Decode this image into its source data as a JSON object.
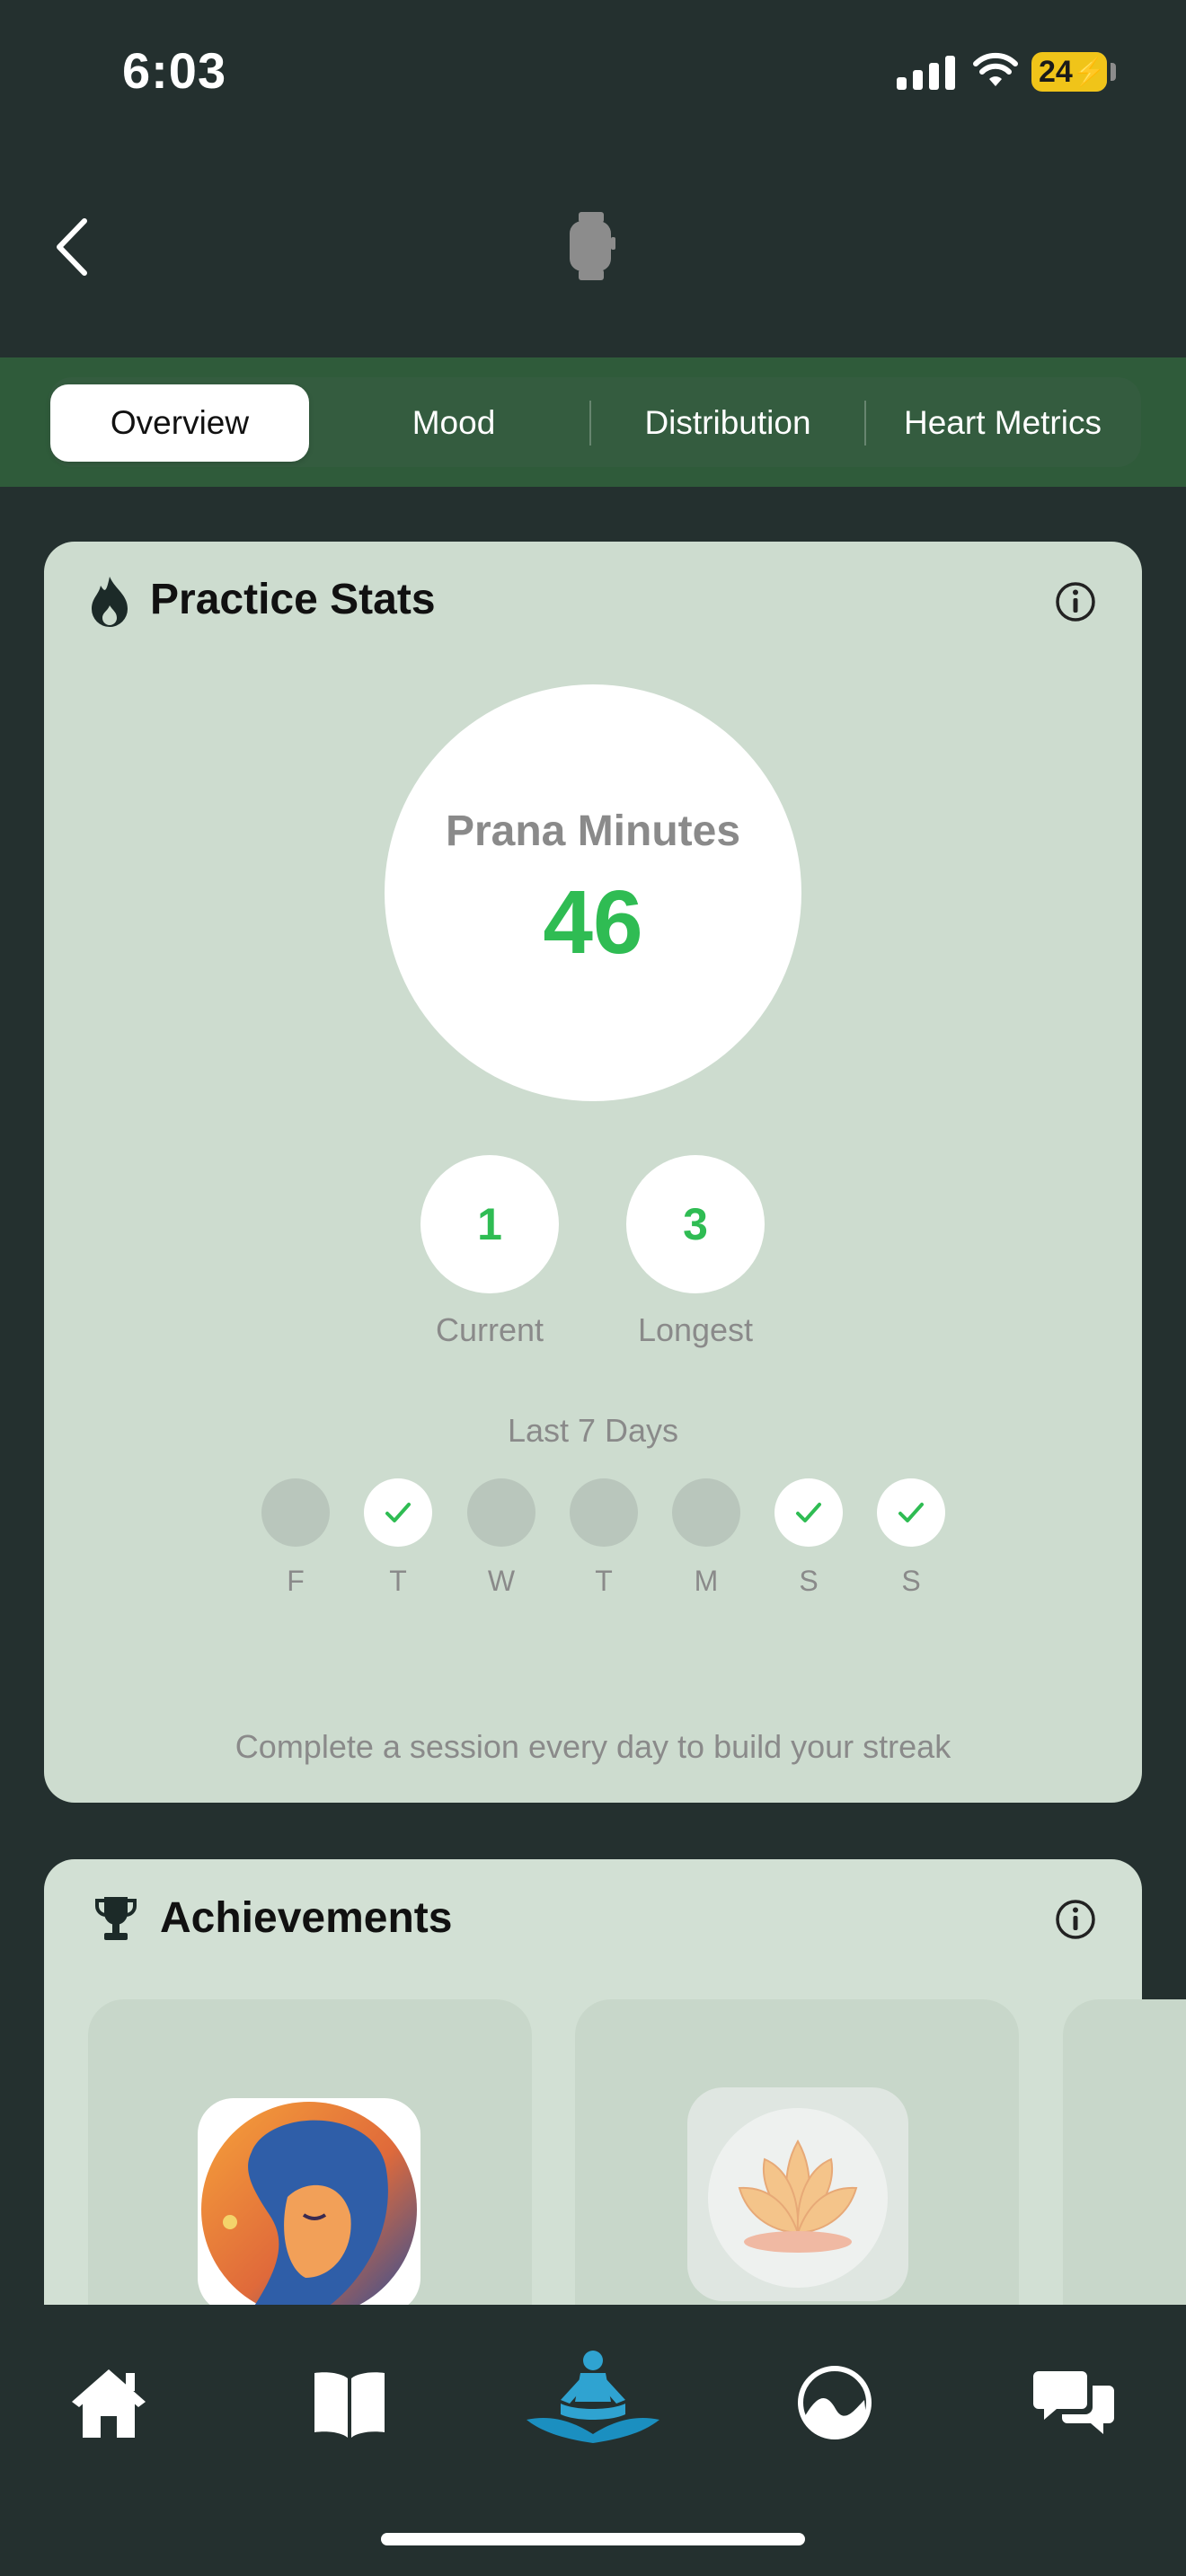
{
  "status_bar": {
    "time": "6:03",
    "battery": "24"
  },
  "tabs": [
    {
      "label": "Overview",
      "active": true
    },
    {
      "label": "Mood",
      "active": false
    },
    {
      "label": "Distribution",
      "active": false
    },
    {
      "label": "Heart Metrics",
      "active": false
    }
  ],
  "practice_stats": {
    "title": "Practice Stats",
    "prana_label": "Prana Minutes",
    "prana_value": "46",
    "current_value": "1",
    "current_label": "Current",
    "longest_value": "3",
    "longest_label": "Longest",
    "last7_label": "Last 7 Days",
    "days": [
      {
        "label": "F",
        "done": false
      },
      {
        "label": "T",
        "done": true
      },
      {
        "label": "W",
        "done": false
      },
      {
        "label": "T",
        "done": false
      },
      {
        "label": "M",
        "done": false
      },
      {
        "label": "S",
        "done": true
      },
      {
        "label": "S",
        "done": true
      }
    ],
    "hint": "Complete a session every day to build your streak"
  },
  "achievements": {
    "title": "Achievements"
  },
  "bottom_nav": [
    "home-icon",
    "library-icon",
    "meditation-icon",
    "insights-icon",
    "community-icon"
  ],
  "colors": {
    "accent_green": "#2fbc53",
    "card_bg": "#cddccf",
    "background": "#24302f",
    "tab_bar": "#2f5b3a"
  }
}
